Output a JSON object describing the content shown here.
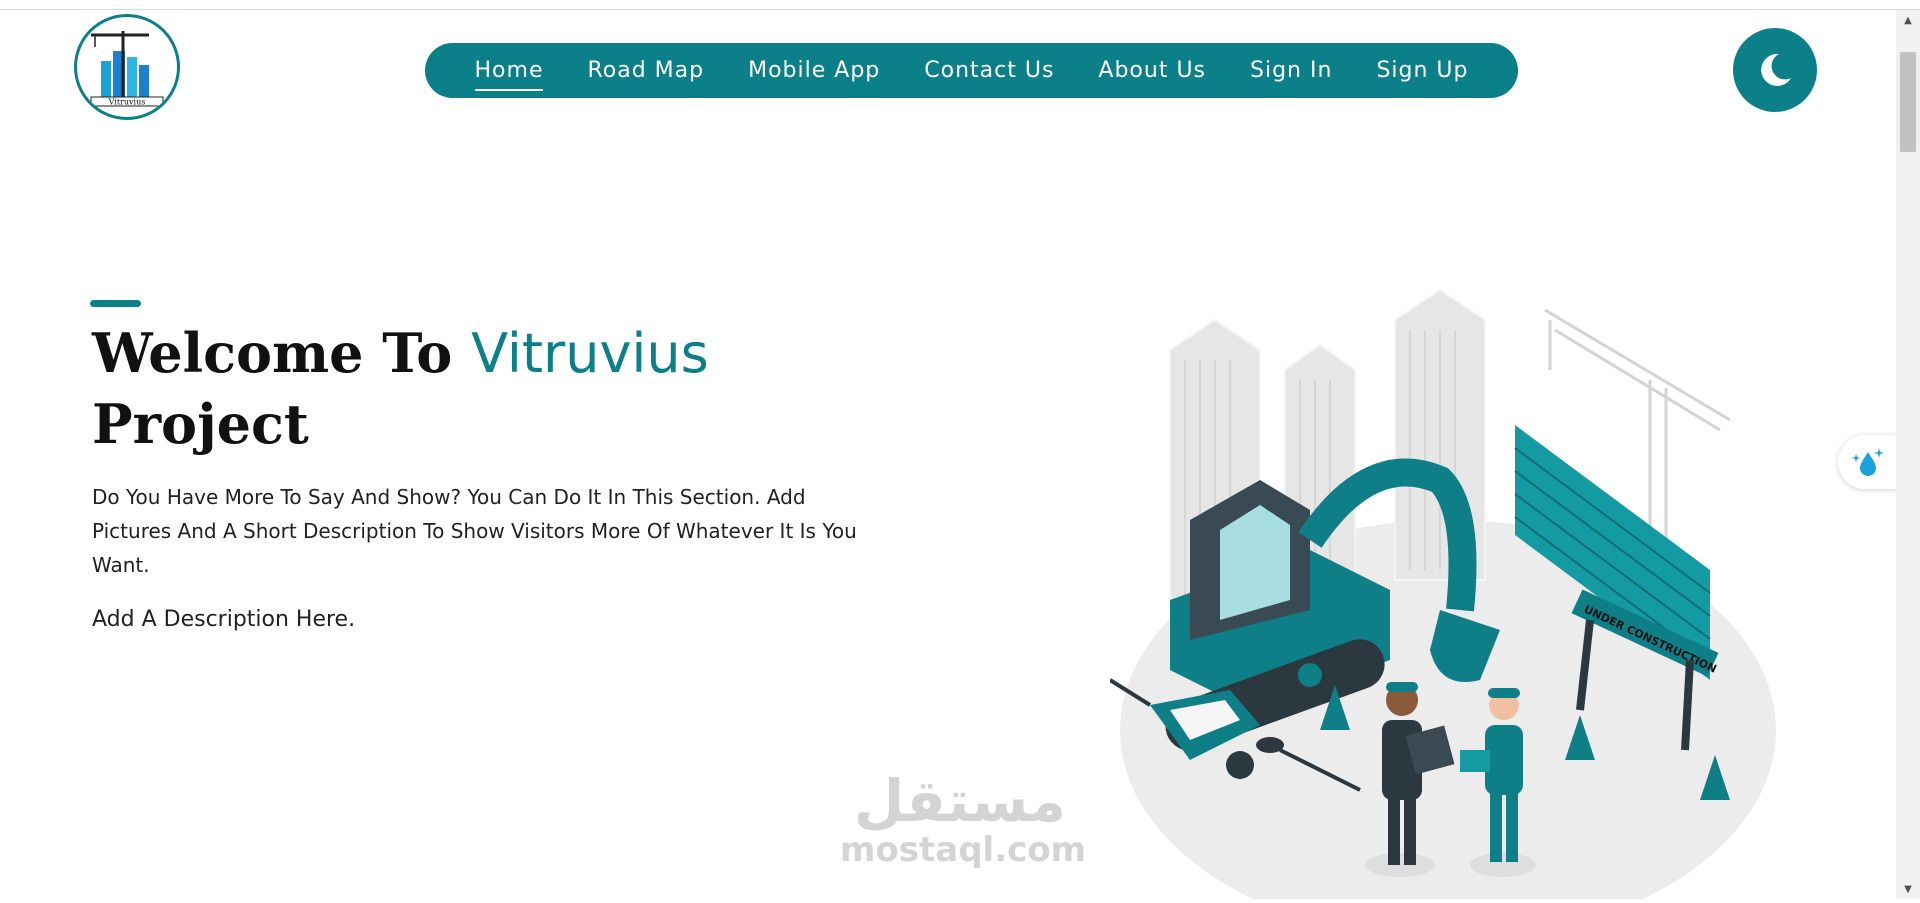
{
  "header": {
    "logo_text": "Vitruvius",
    "nav": [
      {
        "label": "Home",
        "active": true
      },
      {
        "label": "Road Map"
      },
      {
        "label": "Mobile App"
      },
      {
        "label": "Contact Us"
      },
      {
        "label": "About Us"
      },
      {
        "label": "Sign In"
      },
      {
        "label": "Sign Up"
      }
    ],
    "theme_icon": "moon-icon"
  },
  "hero": {
    "title_start": "Welcome To ",
    "title_brand": "Vitruvius",
    "title_end": "Project",
    "description": "Do You Have More To Say And Show? You Can Do It In This Section. Add Pictures And A Short Description To Show Visitors More Of Whatever It Is You Want.",
    "description_2": "Add A Description Here.",
    "illustration_icon": "construction-site-illustration",
    "sign_text": "UNDER CONSTRUCTION"
  },
  "watermark": {
    "arabic": "مستقل",
    "latin": "mostaql.com"
  },
  "side_widget_icon": "water-drop-sparkle-icon",
  "colors": {
    "primary": "#0b8088",
    "text": "#111111",
    "background": "#ffffff"
  }
}
